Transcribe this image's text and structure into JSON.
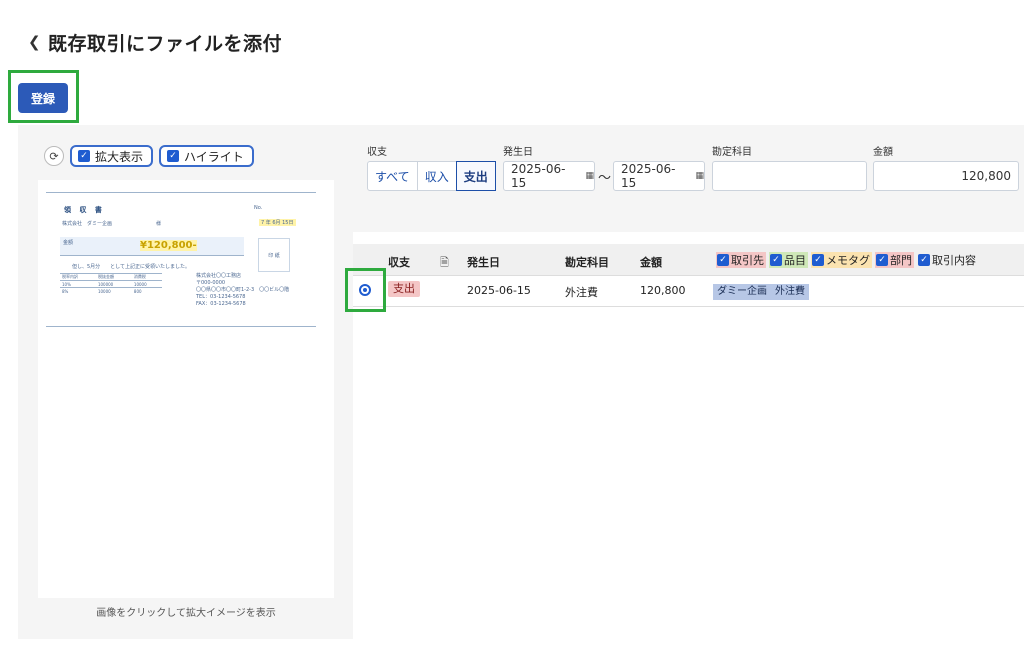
{
  "header": {
    "back_icon": "chevron-left-icon",
    "title": "既存取引にファイルを添付"
  },
  "toolbar": {
    "register_label": "登録"
  },
  "colors": {
    "accent": "#2c5ab8",
    "highlight": "#2eaa3e",
    "expense_badge": "#f4c6c6"
  },
  "preview": {
    "rotate_icon": "rotate-icon",
    "zoom_label": "拡大表示",
    "highlight_label": "ハイライト",
    "caption": "画像をクリックして拡大イメージを表示",
    "receipt": {
      "title": "領 収 書",
      "no": "No.",
      "company": "株式会社　ダミー企画",
      "sama": "様",
      "date": "7 年 6月 15日",
      "amount_label": "金額",
      "amount": "¥120,800-",
      "stamp": "印 紙",
      "note": "但し、5月分　　として上記正に受領いたしました。",
      "table": [
        [
          "税率内訳",
          "税抜金額",
          "消費税"
        ],
        [
          "10%",
          "100000",
          "10000"
        ],
        [
          "8%",
          "10000",
          "800"
        ]
      ],
      "issuer": [
        "株式会社〇〇工務店",
        "〒000-0000",
        "〇〇県〇〇市〇〇町1-2-3　〇〇ビル〇階",
        "TEL：03-1234-5678",
        "FAX：03-1234-5678"
      ]
    }
  },
  "filters": {
    "type_label": "収支",
    "type_options": [
      "すべて",
      "収入",
      "支出"
    ],
    "type_selected": "支出",
    "date_label": "発生日",
    "date_from": "2025-06-15",
    "date_to": "2025-06-15",
    "range_sep": "〜",
    "account_label": "勘定科目",
    "account_value": "",
    "amount_label": "金額",
    "amount_value": "120,800"
  },
  "table": {
    "columns": {
      "type": "収支",
      "doc_icon": "document-icon",
      "date": "発生日",
      "account": "勘定科目",
      "amount": "金額"
    },
    "tag_filters": [
      {
        "label": "取引先",
        "color": "#f4c6c6"
      },
      {
        "label": "品目",
        "color": "#cfe8b8"
      },
      {
        "label": "メモタグ",
        "color": "#fbe3b0"
      },
      {
        "label": "部門",
        "color": "#f4c6c6"
      },
      {
        "label": "取引内容",
        "color": "#ffffff"
      }
    ],
    "rows": [
      {
        "type": "支出",
        "date": "2025-06-15",
        "account": "外注費",
        "amount": "120,800",
        "partner": "ダミー企画",
        "item": "外注費",
        "selected": true
      }
    ]
  }
}
